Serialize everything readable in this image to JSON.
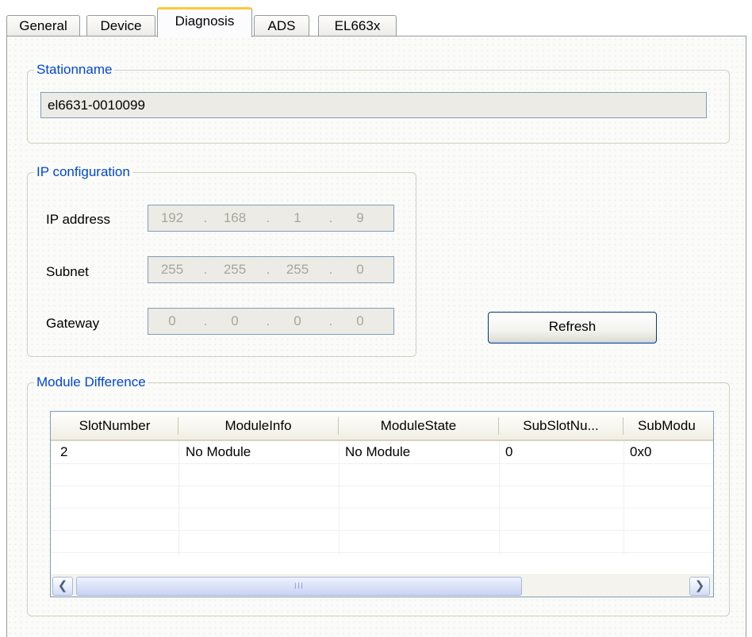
{
  "tabs": [
    {
      "label": "General",
      "active": false
    },
    {
      "label": "Device",
      "active": false
    },
    {
      "label": "Diagnosis",
      "active": true
    },
    {
      "label": "ADS",
      "active": false
    },
    {
      "label": "EL663x",
      "active": false
    }
  ],
  "station": {
    "legend": "Stationname",
    "value": "el6631-0010099"
  },
  "ip_config": {
    "legend": "IP configuration",
    "ip_address": {
      "label": "IP address",
      "octets": [
        "192",
        "168",
        "1",
        "9"
      ]
    },
    "subnet": {
      "label": "Subnet",
      "octets": [
        "255",
        "255",
        "255",
        "0"
      ]
    },
    "gateway": {
      "label": "Gateway",
      "octets": [
        "0",
        "0",
        "0",
        "0"
      ]
    },
    "separator": "."
  },
  "refresh_label": "Refresh",
  "module_difference": {
    "legend": "Module Difference",
    "columns": [
      "SlotNumber",
      "ModuleInfo",
      "ModuleState",
      "SubSlotNu...",
      "SubModu"
    ],
    "rows": [
      [
        "2",
        "No Module",
        "No Module",
        "0",
        "0x0"
      ]
    ],
    "scroll_grip": "III"
  },
  "colors": {
    "legend_text": "#0046d5",
    "active_tab_highlight": "#ffc83c",
    "disabled_text": "#a7a69a"
  }
}
